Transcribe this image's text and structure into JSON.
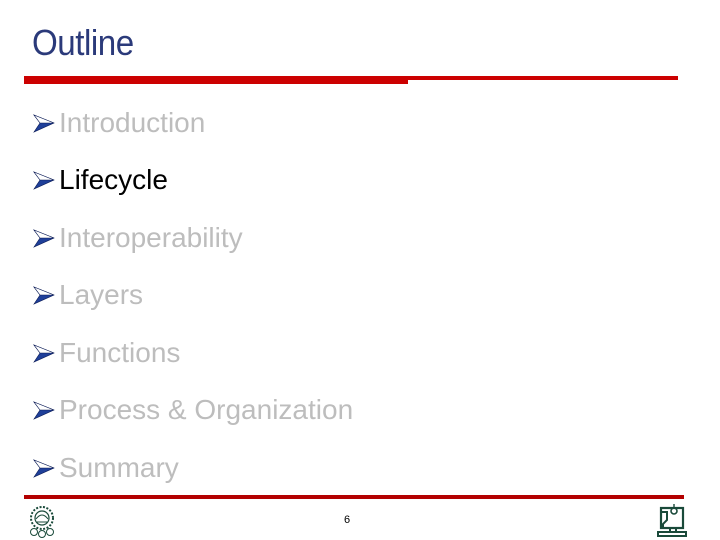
{
  "slide": {
    "title": "Outline",
    "page_number": "6",
    "accent_color": "#cc0000",
    "title_color": "#2b3a7a",
    "bullets": [
      {
        "label": "Introduction",
        "active": false
      },
      {
        "label": "Lifecycle",
        "active": true
      },
      {
        "label": "Interoperability",
        "active": false
      },
      {
        "label": "Layers",
        "active": false
      },
      {
        "label": "Functions",
        "active": false
      },
      {
        "label": "Process & Organization",
        "active": false
      },
      {
        "label": "Summary",
        "active": false
      }
    ],
    "bullet_icon": "arrowhead-icon",
    "footer_left_logo": "university-emblem-icon",
    "footer_right_logo": "computer-terminal-icon"
  }
}
